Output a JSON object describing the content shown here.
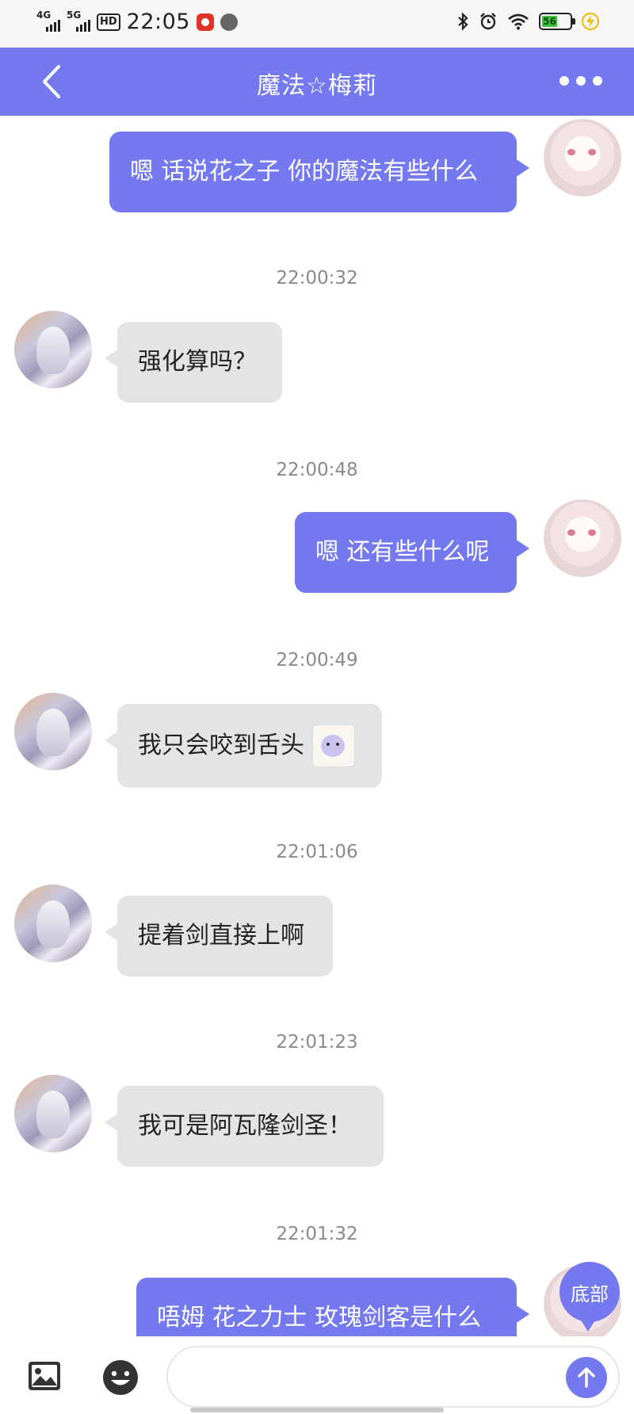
{
  "status_bar": {
    "net1": "4G",
    "net2": "5G",
    "hd": "HD",
    "time": "22:05",
    "battery": "56"
  },
  "header": {
    "title": "魔法☆梅莉"
  },
  "messages": [
    {
      "side": "me",
      "text": "嗯 话说花之子 你的魔法有些什么"
    },
    {
      "timestamp": "22:00:32"
    },
    {
      "side": "other",
      "text": "强化算吗？"
    },
    {
      "timestamp": "22:00:48"
    },
    {
      "side": "me",
      "text": "嗯 还有些什么呢"
    },
    {
      "timestamp": "22:00:49"
    },
    {
      "side": "other",
      "text": "我只会咬到舌头",
      "sticker": "chibi-sticker"
    },
    {
      "timestamp": "22:01:06"
    },
    {
      "side": "other",
      "text": "提着剑直接上啊"
    },
    {
      "timestamp": "22:01:23"
    },
    {
      "side": "other",
      "text": "我可是阿瓦隆剑圣！"
    },
    {
      "timestamp": "22:01:32"
    },
    {
      "side": "me",
      "text": "唔姆 花之力士 玫瑰剑客是什么"
    }
  ],
  "scroll_bottom_label": "底部",
  "colors": {
    "accent": "#7479f0",
    "incoming_bubble": "#e4e4e4"
  }
}
